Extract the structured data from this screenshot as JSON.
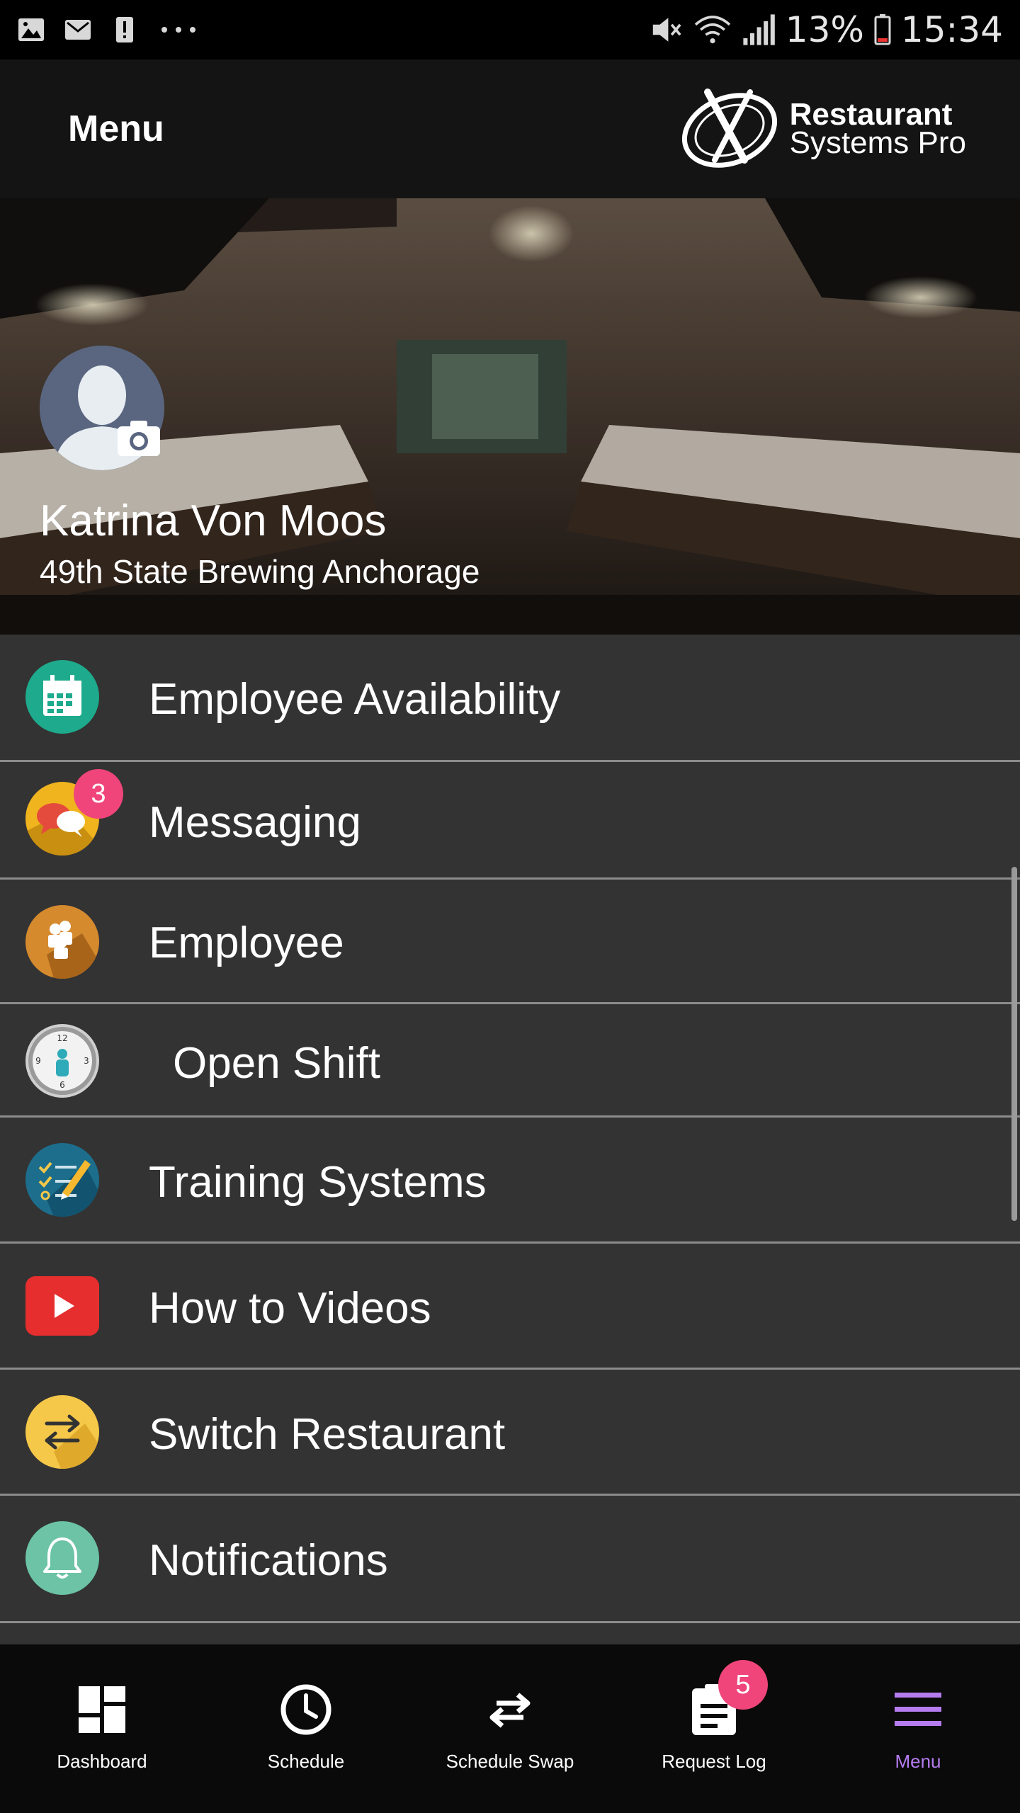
{
  "status_bar": {
    "icons": [
      "image-icon",
      "mail-icon",
      "alert-icon",
      "more-icon",
      "mute-icon",
      "wifi-icon",
      "signal-icon",
      "battery-icon"
    ],
    "battery": "13%",
    "time": "15:34"
  },
  "header": {
    "title": "Menu",
    "logo_line1": "Restaurant",
    "logo_line2": "Systems Pro"
  },
  "profile": {
    "name": "Katrina Von Moos",
    "restaurant": "49th State Brewing Anchorage"
  },
  "menu": {
    "items": [
      {
        "label": "Employee Availability",
        "icon": "calendar-icon",
        "color": "#1eaa8c"
      },
      {
        "label": "Messaging",
        "icon": "chat-icon",
        "color": "#f0b41e",
        "badge": "3"
      },
      {
        "label": "Employee",
        "icon": "people-icon",
        "color": "#d58a2e"
      },
      {
        "label": "Open Shift",
        "icon": "clock-icon",
        "color": "#e0e0e0"
      },
      {
        "label": "Training Systems",
        "icon": "checklist-icon",
        "color": "#1c6e8c"
      },
      {
        "label": "How to Videos",
        "icon": "youtube-icon",
        "color": "#e62e2e"
      },
      {
        "label": "Switch Restaurant",
        "icon": "switch-icon",
        "color": "#f5c84a"
      },
      {
        "label": "Notifications",
        "icon": "bell-icon",
        "color": "#6cc3a6"
      }
    ]
  },
  "bottom_nav": {
    "items": [
      {
        "label": "Dashboard",
        "icon": "dashboard-icon"
      },
      {
        "label": "Schedule",
        "icon": "clock-icon"
      },
      {
        "label": "Schedule Swap",
        "icon": "swap-icon"
      },
      {
        "label": "Request Log",
        "icon": "clipboard-icon",
        "badge": "5"
      },
      {
        "label": "Menu",
        "icon": "hamburger-icon",
        "active": true
      }
    ]
  },
  "colors": {
    "accent": "#b57cf0",
    "badge": "#f0457a",
    "list_bg": "#333333",
    "header_bg": "#141414"
  }
}
